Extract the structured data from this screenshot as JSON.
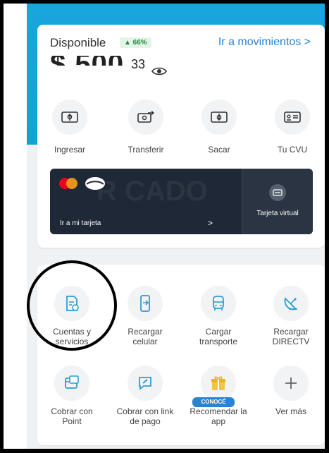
{
  "balance": {
    "label": "Disponible",
    "badge": "▲ 66%",
    "link": "Ir a movimientos >",
    "amount_cents": "33"
  },
  "actions": [
    {
      "label": "Ingresar",
      "icon": "deposit-icon"
    },
    {
      "label": "Transferir",
      "icon": "transfer-icon"
    },
    {
      "label": "Sacar",
      "icon": "withdraw-icon"
    },
    {
      "label": "Tu CVU",
      "icon": "cvu-card-icon"
    }
  ],
  "card_banner": {
    "link": "Ir a mi tarjeta",
    "chevron": ">",
    "virtual": "Tarjeta virtual",
    "watermark": "R CADO"
  },
  "services": [
    {
      "label": "Cuentas y servicios",
      "icon": "bill-payment-icon"
    },
    {
      "label": "Recargar celular",
      "icon": "phone-recharge-icon"
    },
    {
      "label": "Cargar transporte",
      "icon": "bus-icon"
    },
    {
      "label": "Recargar DIRECTV",
      "icon": "satellite-dish-icon"
    },
    {
      "label": "Cobrar con Point",
      "icon": "point-device-icon"
    },
    {
      "label": "Cobrar con link de pago",
      "icon": "payment-link-icon"
    },
    {
      "label": "Recomendar la app",
      "icon": "gift-icon"
    },
    {
      "label": "Ver más",
      "icon": "plus-icon"
    }
  ],
  "promo_badge": "CONOCÉ",
  "colors": {
    "accent_blue": "#2a83cf",
    "top_band": "#19a6dc",
    "banner_dark": "#1f2836",
    "icon_blue": "#2a9fd6"
  }
}
